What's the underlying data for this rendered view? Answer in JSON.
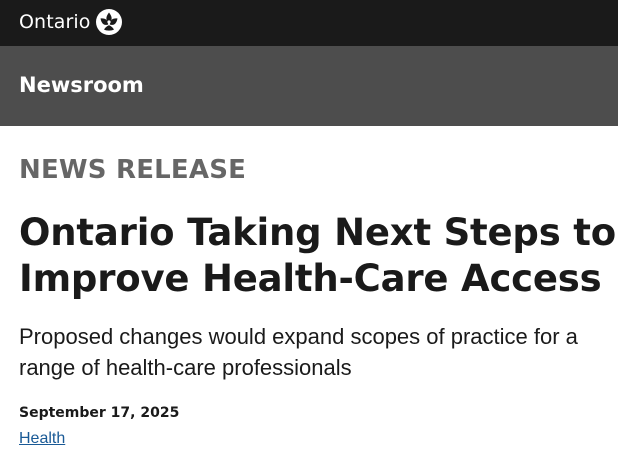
{
  "header": {
    "logo_text": "Ontario",
    "logo_icon": "trillium-icon",
    "background_color": "#1a1a1a"
  },
  "subheader": {
    "title": "Newsroom",
    "background_color": "#4d4d4d"
  },
  "article": {
    "eyebrow": "NEWS RELEASE",
    "headline": "Ontario Taking Next Steps to Improve Health-Care Access",
    "subheadline": "Proposed changes would expand scopes of practice for a range of health-care professionals",
    "date": "September 17, 2025",
    "topic": "Health",
    "link_color": "#1a5a96"
  }
}
